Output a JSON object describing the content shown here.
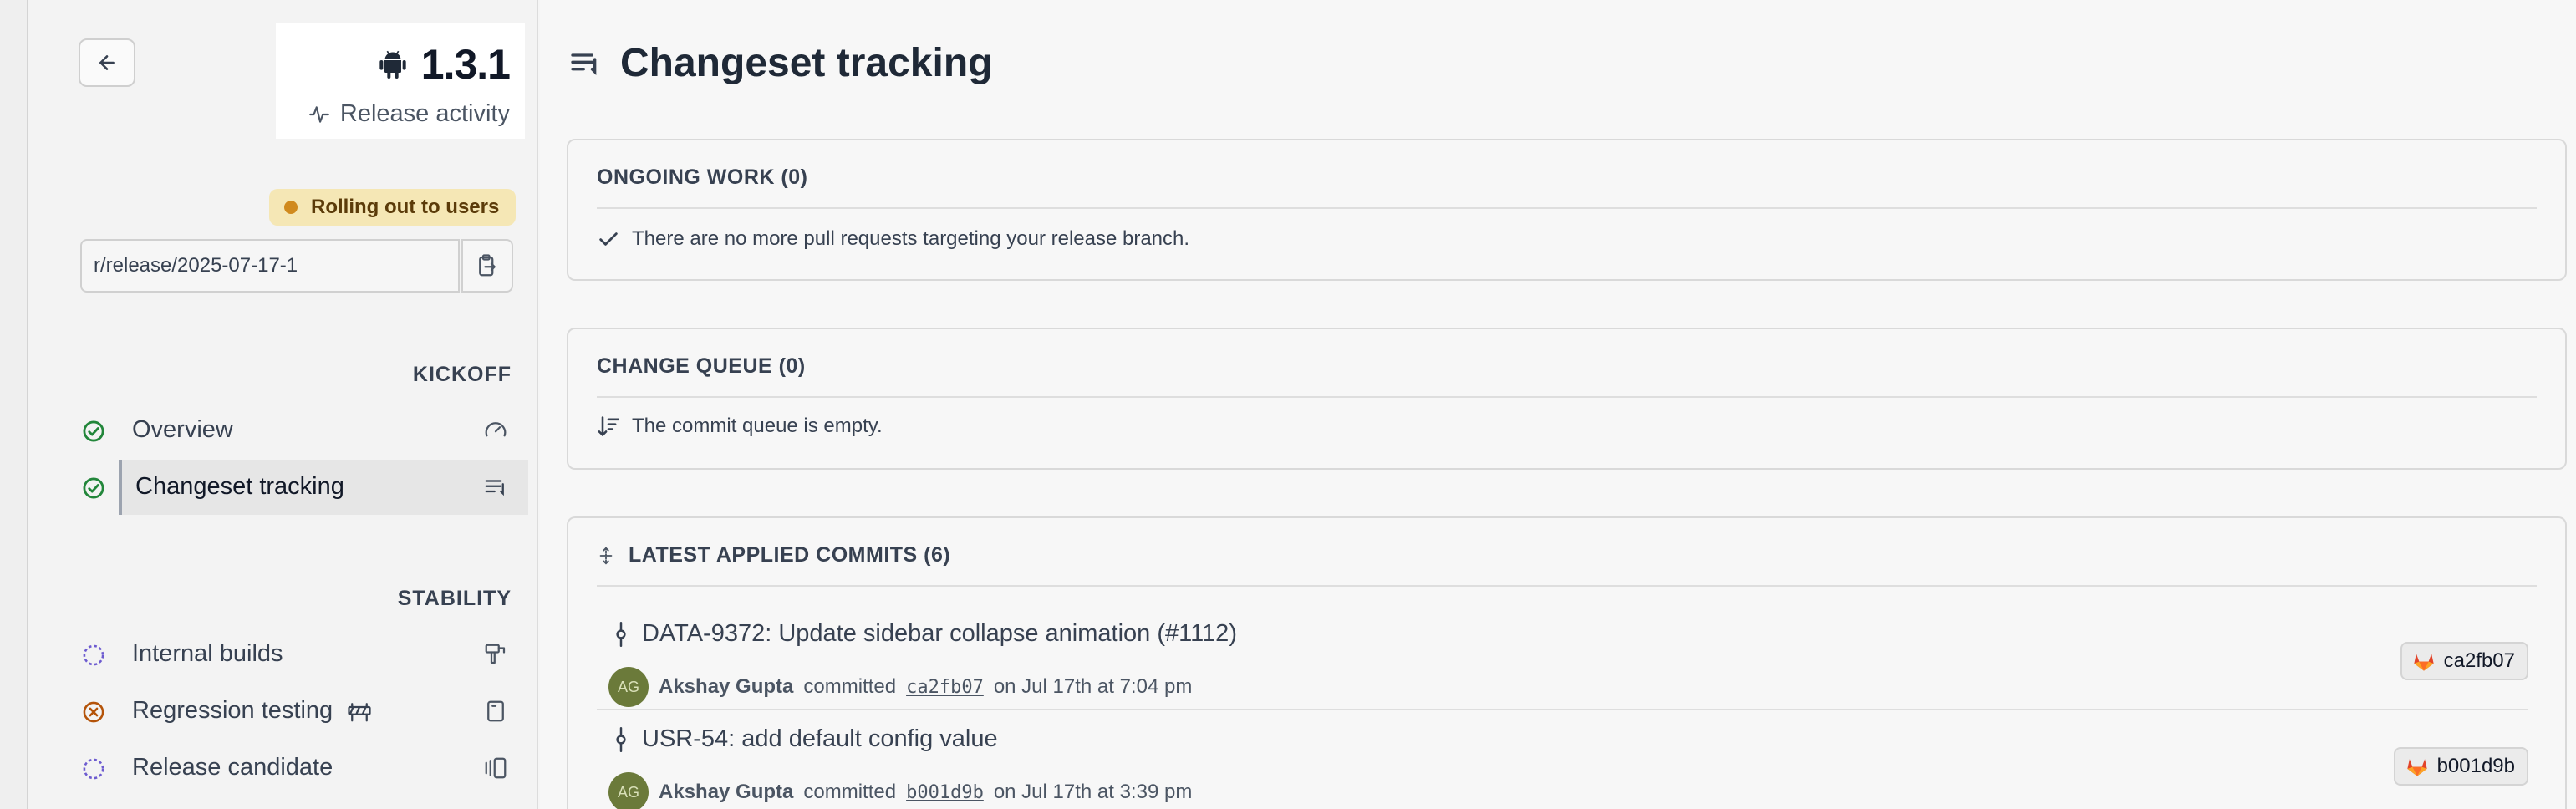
{
  "release": {
    "version": "1.3.1",
    "activity_label": "Release activity",
    "status": "Rolling out to users",
    "branch": "r/release/2025-07-17-1"
  },
  "sidebar": {
    "sections": [
      {
        "heading": "KICKOFF",
        "items": [
          {
            "label": "Overview",
            "status": "done",
            "icon": "gauge-icon"
          },
          {
            "label": "Changeset tracking",
            "status": "done",
            "icon": "list-tracking-icon",
            "active": true
          }
        ]
      },
      {
        "heading": "STABILITY",
        "items": [
          {
            "label": "Internal builds",
            "status": "pending",
            "icon": "build-tool-icon"
          },
          {
            "label": "Regression testing",
            "status": "failed",
            "icon": "tablet-icon",
            "extra_icon": "roadblock-icon"
          },
          {
            "label": "Release candidate",
            "status": "pending",
            "icon": "candidate-icon"
          }
        ]
      }
    ]
  },
  "main": {
    "title": "Changeset tracking",
    "ongoing_work": {
      "title": "ONGOING WORK (0)",
      "message": "There are no more pull requests targeting your release branch."
    },
    "change_queue": {
      "title": "CHANGE QUEUE (0)",
      "message": "The commit queue is empty."
    },
    "latest_commits": {
      "title": "LATEST APPLIED COMMITS (6)",
      "commits": [
        {
          "title": "DATA-9372: Update sidebar collapse animation (#1112)",
          "avatar": "AG",
          "author": "Akshay Gupta",
          "verb": "committed",
          "sha": "ca2fb07",
          "when": "on Jul 17th at 7:04 pm",
          "pill_sha": "ca2fb07"
        },
        {
          "title": "USR-54: add default config value",
          "avatar": "AG",
          "author": "Akshay Gupta",
          "verb": "committed",
          "sha": "b001d9b",
          "when": "on Jul 17th at 3:39 pm",
          "pill_sha": "b001d9b"
        }
      ]
    }
  },
  "colors": {
    "done": "#22863a",
    "pending": "#6d5bd0",
    "failed": "#b45309",
    "badge_bg": "#f5e7b5",
    "badge_dot": "#d08a1e"
  }
}
